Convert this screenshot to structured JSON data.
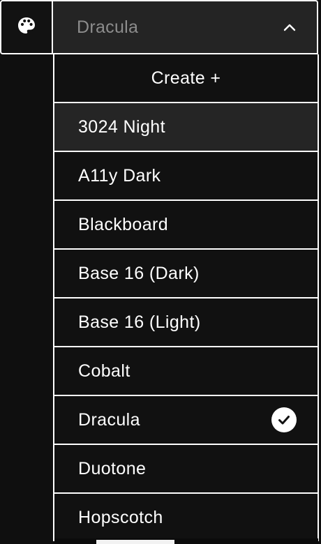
{
  "theme_picker": {
    "selected_value": "Dracula",
    "icon": "palette-icon",
    "chevron": "chevron-up-icon"
  },
  "menu": {
    "create_label": "Create +",
    "items": [
      {
        "label": "3024 Night",
        "hovered": true,
        "selected": false
      },
      {
        "label": "A11y Dark",
        "hovered": false,
        "selected": false
      },
      {
        "label": "Blackboard",
        "hovered": false,
        "selected": false
      },
      {
        "label": "Base 16 (Dark)",
        "hovered": false,
        "selected": false
      },
      {
        "label": "Base 16 (Light)",
        "hovered": false,
        "selected": false
      },
      {
        "label": "Cobalt",
        "hovered": false,
        "selected": false
      },
      {
        "label": "Dracula",
        "hovered": false,
        "selected": true
      },
      {
        "label": "Duotone",
        "hovered": false,
        "selected": false
      },
      {
        "label": "Hopscotch",
        "hovered": false,
        "selected": false
      }
    ]
  },
  "colors": {
    "border": "#ffffff",
    "menu_bg": "#111111",
    "hover_bg": "#252525",
    "head_bg": "#242424",
    "placeholder_text": "#8c8c8c"
  }
}
